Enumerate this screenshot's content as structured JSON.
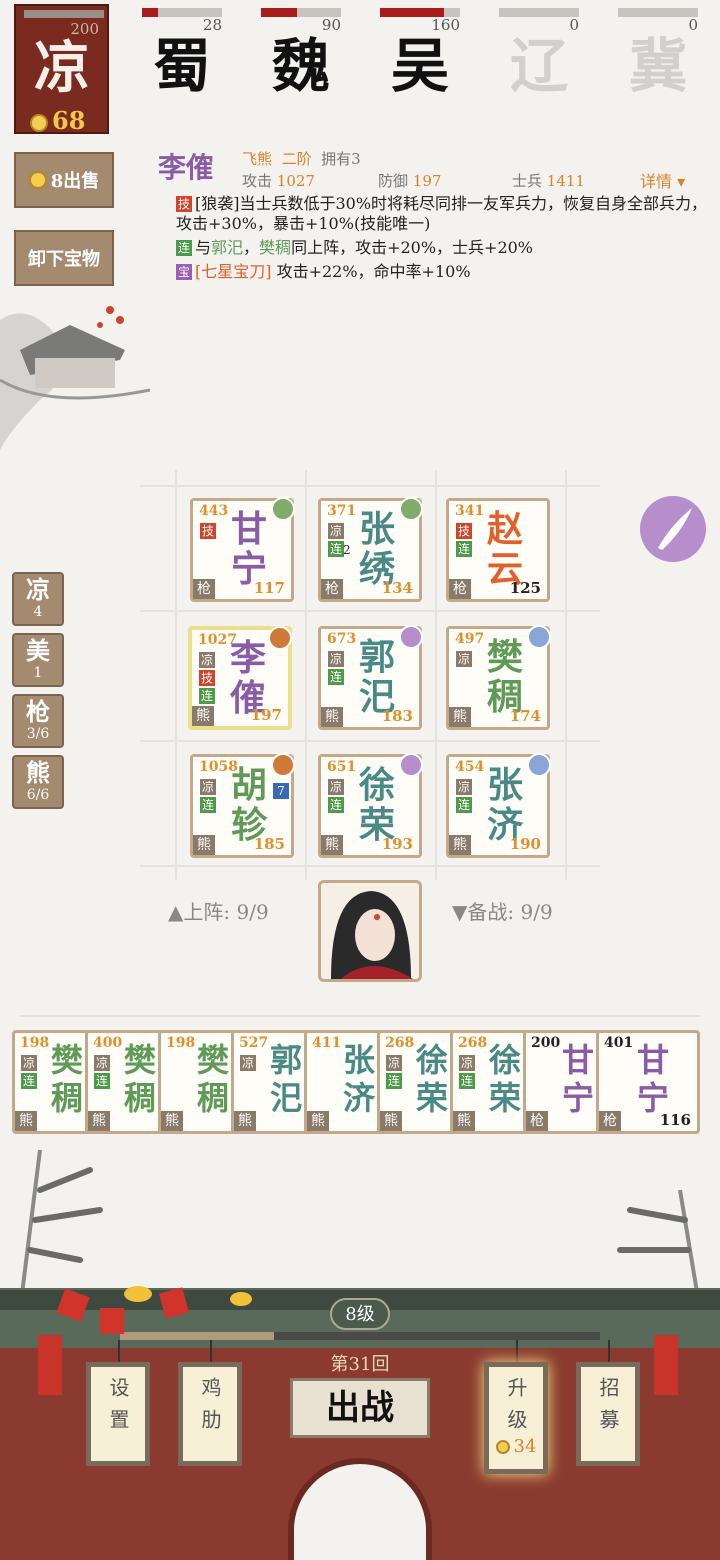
{
  "factions": {
    "current": {
      "name": "凉",
      "count": "200",
      "coins": "68"
    },
    "list": [
      {
        "name": "蜀",
        "value": "28",
        "fill": 0.2
      },
      {
        "name": "魏",
        "value": "90",
        "fill": 0.45
      },
      {
        "name": "吴",
        "value": "160",
        "fill": 0.8
      },
      {
        "name": "辽",
        "value": "0",
        "fill": 0
      },
      {
        "name": "冀",
        "value": "0",
        "fill": 0
      }
    ]
  },
  "side_buttons": {
    "sell": "8出售",
    "unequip": "卸下宝物"
  },
  "hero": {
    "name": "李傕",
    "type": "飞熊",
    "rank": "二阶",
    "own": "拥有3",
    "atk_label": "攻击",
    "atk": "1027",
    "def_label": "防御",
    "def": "197",
    "troop_label": "士兵",
    "troop": "1411",
    "detail": "详情",
    "skill_tag": "技",
    "skill": "[狼袭]当士兵数低于30%时将耗尽同排一友军兵力，恢复自身全部兵力，攻击+30%，暴击+10%(技能唯一)",
    "link_tag": "连",
    "link_pre": "与",
    "link_a": "郭汜",
    "link_sep": "，",
    "link_b": "樊稠",
    "link_post": "同上阵，攻击+20%，士兵+20%",
    "treasure_tag": "宝",
    "treasure": "[七星宝刀]",
    "treasure_post": " 攻击+22%，命中率+10%"
  },
  "filters": [
    {
      "c": "凉",
      "n": "4"
    },
    {
      "c": "美",
      "n": "1"
    },
    {
      "c": "枪",
      "n": "3/6"
    },
    {
      "c": "熊",
      "n": "6/6"
    }
  ],
  "grid": [
    {
      "n1": "甘",
      "n2": "宁",
      "atk": "443",
      "lvl": "117",
      "type": "枪",
      "t1": "技"
    },
    {
      "n1": "张",
      "n2": "绣",
      "atk": "371",
      "lvl": "134",
      "type": "枪",
      "t1": "凉",
      "t2": "连",
      "badge": "2"
    },
    {
      "n1": "赵",
      "n2": "云",
      "atk": "341",
      "lvl": "125",
      "type": "枪",
      "t1": "技",
      "t2": "连"
    },
    {
      "n1": "李",
      "n2": "傕",
      "atk": "1027",
      "lvl": "197",
      "type": "熊",
      "t1": "凉",
      "t2": "技",
      "t3": "连"
    },
    {
      "n1": "郭",
      "n2": "汜",
      "atk": "673",
      "lvl": "183",
      "type": "熊",
      "t1": "凉",
      "t2": "连"
    },
    {
      "n1": "樊",
      "n2": "稠",
      "atk": "497",
      "lvl": "174",
      "type": "熊",
      "t1": "凉"
    },
    {
      "n1": "胡",
      "n2": "轸",
      "atk": "1058",
      "lvl": "185",
      "type": "熊",
      "t1": "凉",
      "t2": "连",
      "badge": "7"
    },
    {
      "n1": "徐",
      "n2": "荣",
      "atk": "651",
      "lvl": "193",
      "type": "熊",
      "t1": "凉",
      "t2": "连"
    },
    {
      "n1": "张",
      "n2": "济",
      "atk": "454",
      "lvl": "190",
      "type": "熊",
      "t1": "凉",
      "t2": "连"
    }
  ],
  "deploy": {
    "on": "▲上阵: 9/9",
    "reserve": "▼备战: 9/9"
  },
  "bench": [
    {
      "n1": "樊",
      "n2": "稠",
      "atk": "198",
      "type": "熊",
      "t1": "凉",
      "t2": "连"
    },
    {
      "n1": "樊",
      "n2": "稠",
      "atk": "400",
      "type": "熊",
      "t1": "凉",
      "t2": "连"
    },
    {
      "n1": "樊",
      "n2": "稠",
      "atk": "198",
      "type": "熊"
    },
    {
      "n1": "郭",
      "n2": "汜",
      "atk": "527",
      "type": "熊",
      "t1": "凉"
    },
    {
      "n1": "张",
      "n2": "济",
      "atk": "411",
      "type": "熊"
    },
    {
      "n1": "徐",
      "n2": "荣",
      "atk": "268",
      "type": "熊",
      "t1": "凉",
      "t2": "连"
    },
    {
      "n1": "徐",
      "n2": "荣",
      "atk": "268",
      "type": "熊",
      "t1": "凉",
      "t2": "连"
    },
    {
      "n1": "甘",
      "n2": "宁",
      "atk": "200",
      "type": "枪"
    },
    {
      "n1": "甘",
      "n2": "宁",
      "atk": "401",
      "type": "枪",
      "lvl": "116"
    }
  ],
  "bottom": {
    "level": "8级",
    "round": "第31回",
    "battle": "出战",
    "settings": "设置",
    "rib": "鸡肋",
    "upgrade": "升级",
    "upgrade_cost": "34",
    "recruit": "招募"
  }
}
